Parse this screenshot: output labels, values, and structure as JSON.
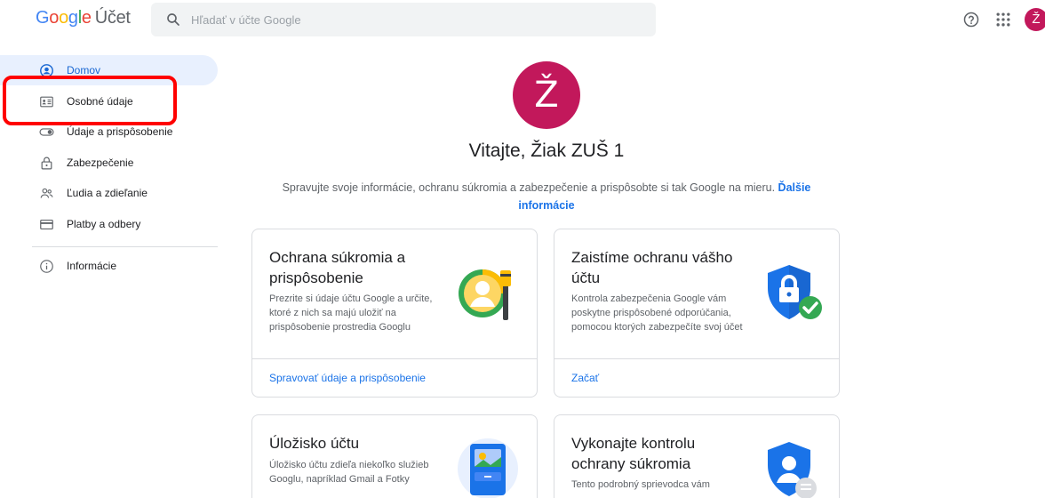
{
  "header": {
    "logo_letters": [
      "G",
      "o",
      "o",
      "g",
      "l",
      "e"
    ],
    "product": "Účet",
    "search_placeholder": "Hľadať v účte Google",
    "avatar_initial": "Ž"
  },
  "sidebar": {
    "items": [
      {
        "label": "Domov",
        "icon": "home-icon",
        "active": true
      },
      {
        "label": "Osobné údaje",
        "icon": "id-card-icon",
        "active": false
      },
      {
        "label": "Údaje a prispôsobenie",
        "icon": "toggle-icon",
        "active": false
      },
      {
        "label": "Zabezpečenie",
        "icon": "lock-icon",
        "active": false
      },
      {
        "label": "Ľudia a zdieľanie",
        "icon": "people-icon",
        "active": false
      },
      {
        "label": "Platby a odbery",
        "icon": "credit-card-icon",
        "active": false
      }
    ],
    "footer_item": {
      "label": "Informácie",
      "icon": "info-icon"
    }
  },
  "main": {
    "avatar_initial": "Ž",
    "welcome": "Vitajte, Žiak ZUŠ 1",
    "intro_text": "Spravujte svoje informácie, ochranu súkromia a zabezpečenie a prispôsobte si tak Google na mieru.",
    "intro_link": "Ďalšie informácie",
    "cards": [
      {
        "title": "Ochrana súkromia a prispôsobenie",
        "description": "Prezrite si údaje účtu Google a určite, ktoré z nich sa majú uložiť na prispôsobenie prostredia Googlu",
        "link": "Spravovať údaje a prispôsobenie",
        "illustration": "privacy-illustration-icon"
      },
      {
        "title": "Zaistíme ochranu vášho účtu",
        "description": "Kontrola zabezpečenia Google vám poskytne prispôsobené odporúčania, pomocou ktorých zabezpečíte svoj účet",
        "link": "Začať",
        "illustration": "security-shield-icon"
      },
      {
        "title": "Úložisko účtu",
        "description": "Úložisko účtu zdieľa niekoľko služieb Googlu, napríklad Gmail a Fotky",
        "illustration": "storage-illustration-icon"
      },
      {
        "title": "Vykonajte kontrolu ochrany súkromia",
        "description": "Tento podrobný sprievodca vám",
        "illustration": "privacy-checkup-icon"
      }
    ]
  },
  "colors": {
    "accent": "#1a73e8",
    "avatar": "#c2185b",
    "highlight": "#ff0000",
    "active_nav_bg": "#e8f0fe"
  }
}
